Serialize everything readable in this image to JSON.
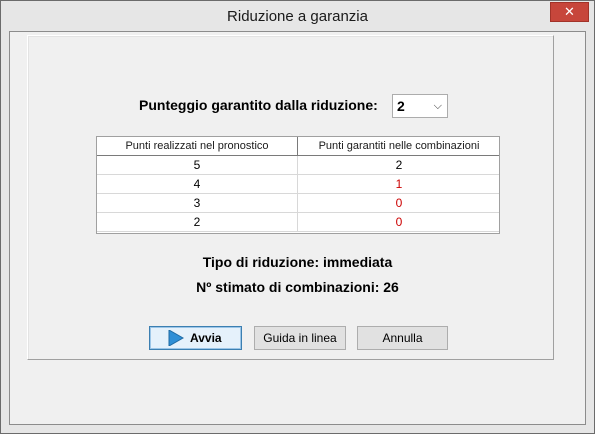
{
  "window": {
    "title": "Riduzione a garanzia",
    "close_glyph": "✕"
  },
  "guarantee": {
    "label": "Punteggio garantito dalla riduzione:",
    "selected": "2"
  },
  "table": {
    "headers": [
      "Punti realizzati nel pronostico",
      "Punti garantiti nelle combinazioni"
    ],
    "rows": [
      {
        "realized": "5",
        "guaranteed": "2",
        "color": "#000000"
      },
      {
        "realized": "4",
        "guaranteed": "1",
        "color": "#cc0000"
      },
      {
        "realized": "3",
        "guaranteed": "0",
        "color": "#cc0000"
      },
      {
        "realized": "2",
        "guaranteed": "0",
        "color": "#cc0000"
      }
    ]
  },
  "info": {
    "reduction_type": "Tipo di riduzione: immediata",
    "estimated": "Nº stimato di combinazioni: 26"
  },
  "buttons": {
    "start": "Avvia",
    "help": "Guida in linea",
    "cancel": "Annulla"
  },
  "icons": {
    "start": "play-icon",
    "select": "chevron-down-icon",
    "close": "close-icon"
  },
  "colors": {
    "accent": "#3c7fb1",
    "close": "#c7463b",
    "red_value": "#cc0000"
  }
}
